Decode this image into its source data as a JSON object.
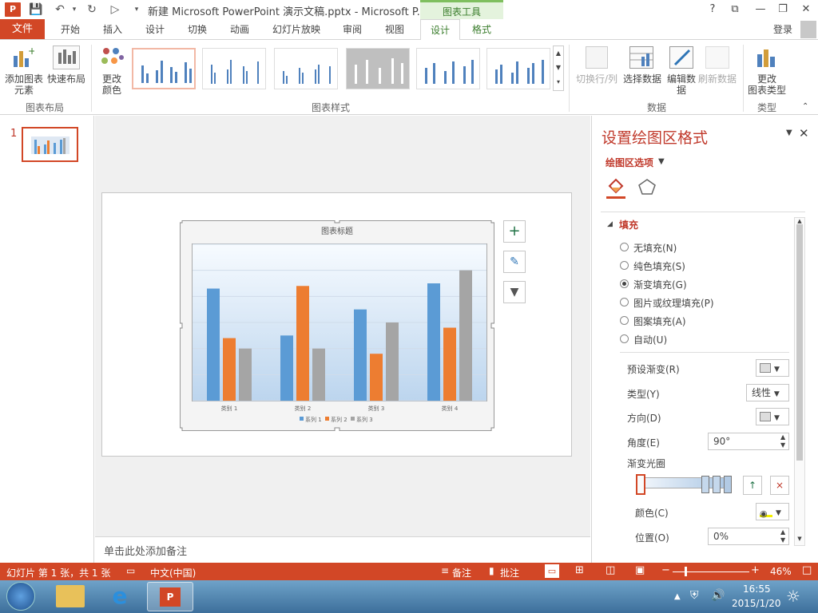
{
  "titlebar": {
    "title": "新建 Microsoft PowerPoint 演示文稿.pptx - Microsoft P...",
    "context_tab": "图表工具",
    "help": "?",
    "controls": [
      "?",
      "⧉",
      "—",
      "❐",
      "✕"
    ]
  },
  "tabs": {
    "file": "文件",
    "items": [
      "开始",
      "插入",
      "设计",
      "切换",
      "动画",
      "幻灯片放映",
      "审阅",
      "视图",
      "设计",
      "格式"
    ],
    "active_index": 8,
    "login": "登录"
  },
  "ribbon": {
    "add_element": "添加图表",
    "add_element2": "元素",
    "quick_layout": "快速布局",
    "change_color": "更改",
    "change_color2": "颜色",
    "group_layout": "图表布局",
    "group_styles": "图表样式",
    "switch_row_col": "切换行/列",
    "select_data": "选择数据",
    "edit_data": "编辑数",
    "edit_data2": "据",
    "refresh_data": "刷新数据",
    "group_data": "数据",
    "change_type": "更改",
    "change_type2": "图表类型",
    "group_type": "类型"
  },
  "slides_panel": {
    "slide_number": "1"
  },
  "chart": {
    "title": "图表标题",
    "legend": [
      "系列 1",
      "系列 2",
      "系列 3"
    ],
    "categories": [
      "类别 1",
      "类别 2",
      "类别 3",
      "类别 4"
    ]
  },
  "chart_data": {
    "type": "bar",
    "title": "图表标题",
    "categories": [
      "类别 1",
      "类别 2",
      "类别 3",
      "类别 4"
    ],
    "series": [
      {
        "name": "系列 1",
        "color": "#5b9bd5",
        "values": [
          4.3,
          2.5,
          3.5,
          4.5
        ]
      },
      {
        "name": "系列 2",
        "color": "#ed7d31",
        "values": [
          2.4,
          4.4,
          1.8,
          2.8
        ]
      },
      {
        "name": "系列 3",
        "color": "#a5a5a5",
        "values": [
          2.0,
          2.0,
          3.0,
          5.0
        ]
      }
    ],
    "ylim": [
      0,
      6
    ],
    "grid": true,
    "legend_position": "bottom"
  },
  "notes": {
    "placeholder": "单击此处添加备注"
  },
  "pane": {
    "title": "设置绘图区格式",
    "options_label": "绘图区选项",
    "section": "填充",
    "fill_options": [
      "无填充(N)",
      "纯色填充(S)",
      "渐变填充(G)",
      "图片或纹理填充(P)",
      "图案填充(A)",
      "自动(U)"
    ],
    "selected_fill": 2,
    "preset_label": "预设渐变(R)",
    "type_label": "类型(Y)",
    "type_value": "线性",
    "direction_label": "方向(D)",
    "angle_label": "角度(E)",
    "angle_value": "90°",
    "stops_label": "渐变光圈",
    "color_label": "颜色(C)",
    "position_label": "位置(O)",
    "position_value": "0%"
  },
  "status": {
    "slide_info": "幻灯片 第 1 张，共 1 张",
    "language": "中文(中国)",
    "notes": "备注",
    "comments": "批注",
    "zoom": "46%"
  },
  "taskbar": {
    "time": "16:55",
    "date": "2015/1/20"
  }
}
